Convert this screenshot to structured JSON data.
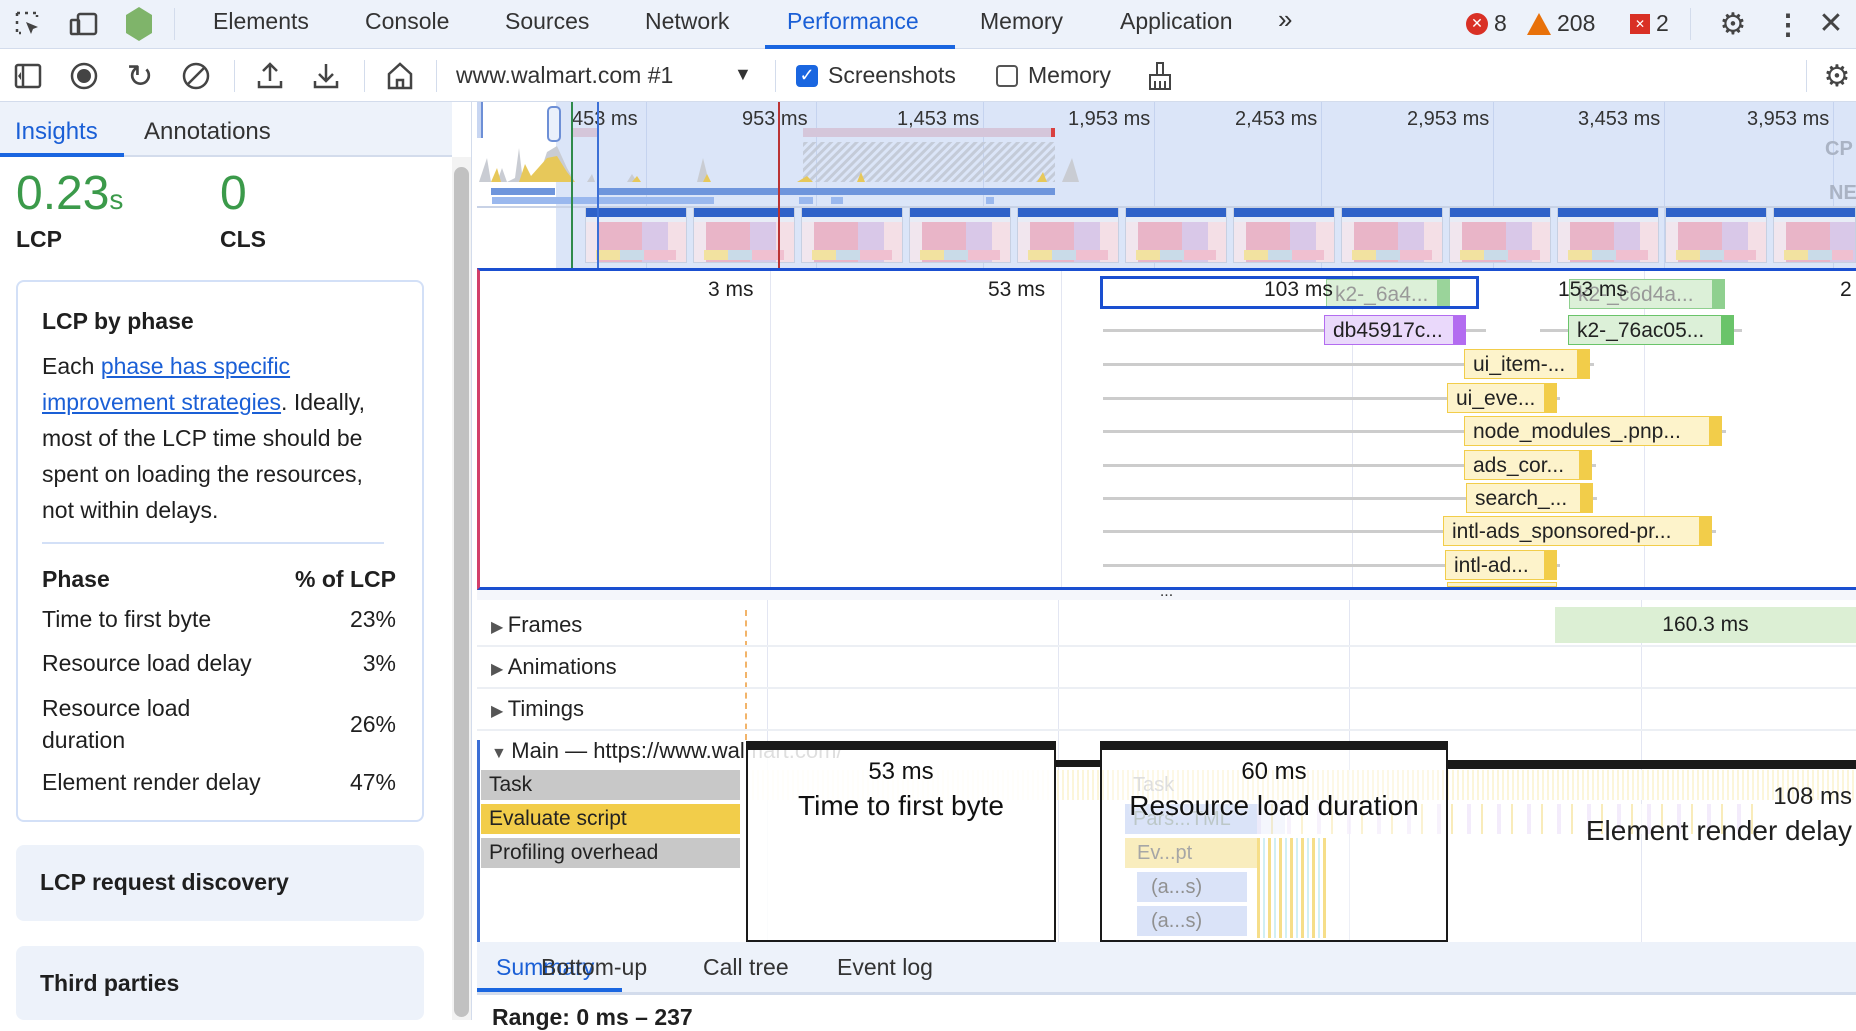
{
  "topbar": {
    "tabs": [
      "Elements",
      "Console",
      "Sources",
      "Network",
      "Performance",
      "Memory",
      "Application"
    ],
    "active_tab": "Performance",
    "more_tabs": "»",
    "errors": "8",
    "warnings": "208",
    "issues": "2",
    "colors": {
      "accent": "#1a66e0",
      "error": "#d93025",
      "warning": "#e8710a"
    }
  },
  "toolbar": {
    "recording_select": "www.walmart.com #1",
    "screenshots_label": "Screenshots",
    "screenshots_checked": true,
    "memory_label": "Memory",
    "memory_checked": false
  },
  "sidebar": {
    "tabs": [
      "Insights",
      "Annotations"
    ],
    "active_tab": "Insights",
    "lcp": {
      "value": "0.23",
      "unit": "s",
      "label": "LCP"
    },
    "cls": {
      "value": "0",
      "label": "CLS"
    },
    "lcp_phase": {
      "title": "LCP by phase",
      "text_before": "Each ",
      "link": "phase has specific improvement strategies",
      "text_after": ". Ideally, most of the LCP time should be spent on loading the resources, not within delays.",
      "col_phase": "Phase",
      "col_pct": "% of LCP",
      "rows": [
        {
          "phase": "Time to first byte",
          "pct": "23%"
        },
        {
          "phase": "Resource load delay",
          "pct": "3%"
        },
        {
          "phase": "Resource load duration",
          "pct": "26%"
        },
        {
          "phase": "Element render delay",
          "pct": "47%"
        }
      ]
    },
    "cards": [
      "LCP request discovery",
      "Third parties"
    ]
  },
  "overview": {
    "ticks": [
      "453 ms",
      "953 ms",
      "1,453 ms",
      "1,953 ms",
      "2,453 ms",
      "2,953 ms",
      "3,453 ms",
      "3,953 ms"
    ],
    "cpu_label": "CP",
    "net_label": "NE"
  },
  "flame": {
    "ticks": [
      "3 ms",
      "53 ms",
      "103 ms",
      "153 ms",
      "2"
    ],
    "entries": [
      "k2-_6a4...",
      "k2-_c6d4a...",
      "db45917c...",
      "k2-_76ac05...",
      "ui_item-...",
      "ui_eve...",
      "node_modules_.pnp...",
      "ads_cor...",
      "search_...",
      "intl-ads_sponsored-pr...",
      "intl-ad..."
    ],
    "divider": "..."
  },
  "tracks": {
    "frames": "Frames",
    "frames_value": "160.3 ms",
    "animations": "Animations",
    "timings": "Timings",
    "main": "Main — https://www.walmart.com/",
    "legend": [
      "Task",
      "Evaluate script",
      "Profiling overhead"
    ],
    "inner": [
      "Task",
      "Pars...TML",
      "Ev...pt",
      "(a...s)",
      "(a...s)"
    ],
    "phases": [
      {
        "ms": "53 ms",
        "name": "Time to first byte"
      },
      {
        "ms": "60 ms",
        "name": "Resource load duration"
      },
      {
        "ms": "108 ms",
        "name": "Element render delay"
      }
    ]
  },
  "bottom": {
    "tabs": [
      "Summary",
      "Bottom-up",
      "Call tree",
      "Event log"
    ],
    "active_tab": "Summary",
    "range": "Range: 0 ms – 237"
  }
}
